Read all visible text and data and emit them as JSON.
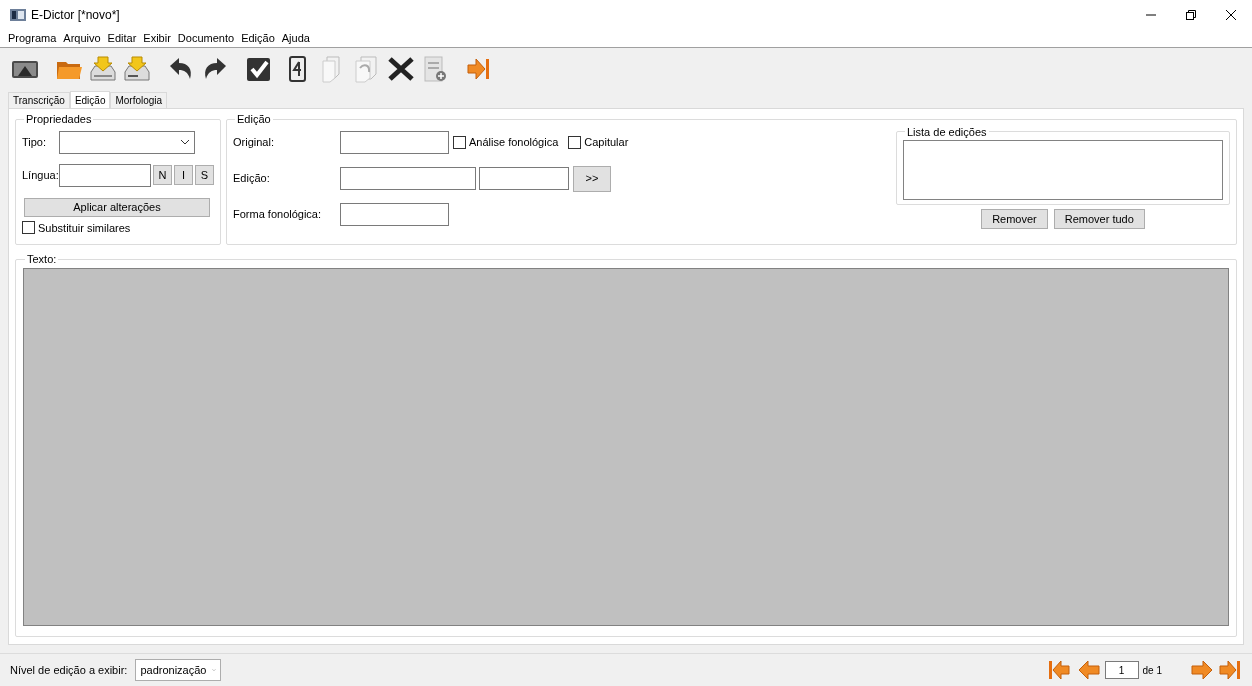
{
  "window": {
    "title": "E-Dictor [*novo*]"
  },
  "menu": [
    "Programa",
    "Arquivo",
    "Editar",
    "Exibir",
    "Documento",
    "Edição",
    "Ajuda"
  ],
  "tabs": [
    {
      "label": "Transcrição",
      "selected": false
    },
    {
      "label": "Edição",
      "selected": true
    },
    {
      "label": "Morfologia",
      "selected": false
    }
  ],
  "properties": {
    "title": "Propriedades",
    "type_label": "Tipo:",
    "language_label": "Língua:",
    "style_buttons": [
      "N",
      "I",
      "S"
    ],
    "apply_button": "Aplicar alterações",
    "replace_similar": {
      "label": "Substituir similares",
      "checked": false
    }
  },
  "edition": {
    "title": "Edição",
    "original_label": "Original:",
    "phonological_analysis": {
      "label": "Análise fonológica",
      "checked": false
    },
    "capitular": {
      "label": "Capitular",
      "checked": false
    },
    "edition_label": "Edição:",
    "transfer_button": ">>",
    "phonological_form_label": "Forma fonológica:"
  },
  "edits_list": {
    "title": "Lista de edições",
    "buttons": [
      "Remover",
      "Remover tudo"
    ]
  },
  "text_panel": {
    "title": "Texto:"
  },
  "footer": {
    "level_label": "Nível de edição a exibir:",
    "level_value": "padronização",
    "page": "1",
    "page_total": "de 1"
  }
}
